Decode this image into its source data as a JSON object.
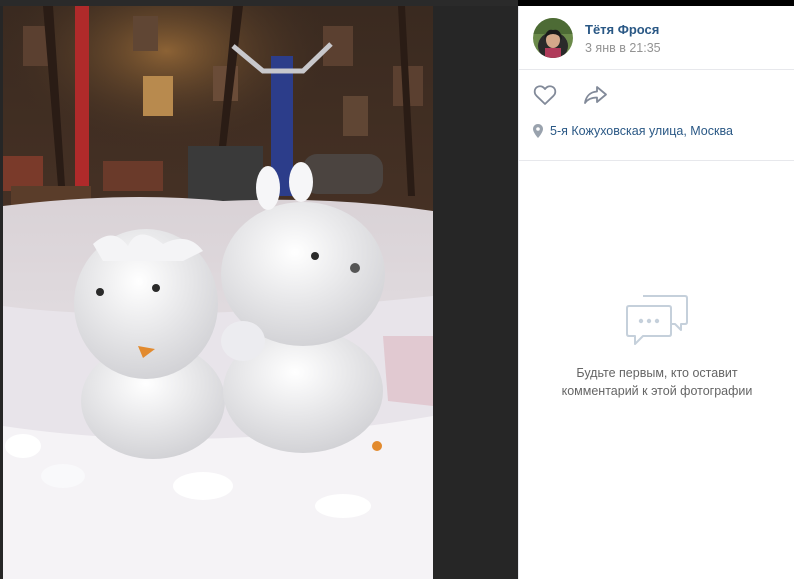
{
  "post": {
    "author": "Тётя Фрося",
    "date": "3 янв в 21:35",
    "location": "5-я Кожуховская улица, Москва"
  },
  "icons": {
    "like": "heart-icon",
    "share": "share-arrow-icon",
    "location": "map-pin-icon",
    "comments_empty": "chat-bubbles-icon"
  },
  "comments": {
    "empty_line1": "Будьте первым, кто оставит",
    "empty_line2": "комментарий к этой фотографии"
  },
  "colors": {
    "link": "#2a5885",
    "muted": "#939393",
    "icon": "#99a2ad",
    "empty_text": "#656565",
    "viewer_bg": "#262626"
  }
}
